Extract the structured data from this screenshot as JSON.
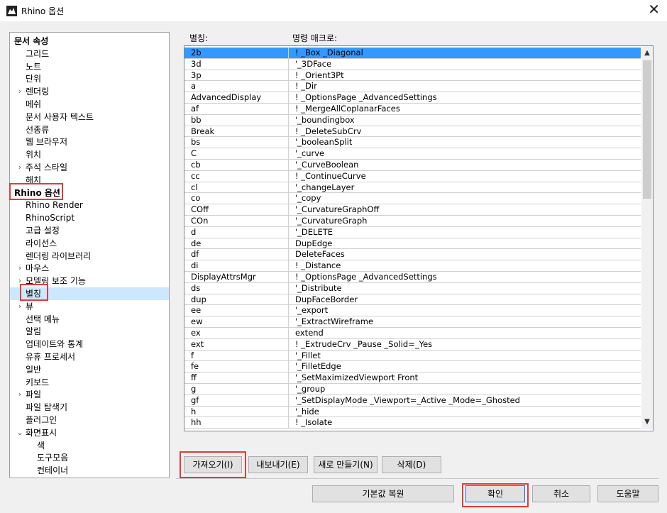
{
  "window": {
    "title": "Rhino 옵션",
    "close_glyph": "✕"
  },
  "tree": [
    {
      "label": "문서 속성",
      "indent": 0,
      "bold": true,
      "arrow": ""
    },
    {
      "label": "그리드",
      "indent": 1,
      "bold": false,
      "arrow": ""
    },
    {
      "label": "노트",
      "indent": 1,
      "bold": false,
      "arrow": ""
    },
    {
      "label": "단위",
      "indent": 1,
      "bold": false,
      "arrow": ""
    },
    {
      "label": "렌더링",
      "indent": 1,
      "bold": false,
      "arrow": "›"
    },
    {
      "label": "메쉬",
      "indent": 1,
      "bold": false,
      "arrow": ""
    },
    {
      "label": "문서 사용자 텍스트",
      "indent": 1,
      "bold": false,
      "arrow": ""
    },
    {
      "label": "선종류",
      "indent": 1,
      "bold": false,
      "arrow": ""
    },
    {
      "label": "웹 브라우저",
      "indent": 1,
      "bold": false,
      "arrow": ""
    },
    {
      "label": "위치",
      "indent": 1,
      "bold": false,
      "arrow": ""
    },
    {
      "label": "주석 스타일",
      "indent": 1,
      "bold": false,
      "arrow": "›"
    },
    {
      "label": "해치",
      "indent": 1,
      "bold": false,
      "arrow": ""
    },
    {
      "label": "Rhino 옵션",
      "indent": 0,
      "bold": true,
      "arrow": ""
    },
    {
      "label": "Rhino Render",
      "indent": 1,
      "bold": false,
      "arrow": ""
    },
    {
      "label": "RhinoScript",
      "indent": 1,
      "bold": false,
      "arrow": ""
    },
    {
      "label": "고급 설정",
      "indent": 1,
      "bold": false,
      "arrow": ""
    },
    {
      "label": "라이선스",
      "indent": 1,
      "bold": false,
      "arrow": ""
    },
    {
      "label": "렌더링 라이브러리",
      "indent": 1,
      "bold": false,
      "arrow": ""
    },
    {
      "label": "마우스",
      "indent": 1,
      "bold": false,
      "arrow": "›"
    },
    {
      "label": "모델링 보조 기능",
      "indent": 1,
      "bold": false,
      "arrow": "›"
    },
    {
      "label": "별칭",
      "indent": 1,
      "bold": false,
      "arrow": "",
      "selected": true
    },
    {
      "label": "뷰",
      "indent": 1,
      "bold": false,
      "arrow": "›"
    },
    {
      "label": "선택 메뉴",
      "indent": 1,
      "bold": false,
      "arrow": ""
    },
    {
      "label": "알림",
      "indent": 1,
      "bold": false,
      "arrow": ""
    },
    {
      "label": "업데이트와 통계",
      "indent": 1,
      "bold": false,
      "arrow": ""
    },
    {
      "label": "유휴 프로세서",
      "indent": 1,
      "bold": false,
      "arrow": ""
    },
    {
      "label": "일반",
      "indent": 1,
      "bold": false,
      "arrow": ""
    },
    {
      "label": "키보드",
      "indent": 1,
      "bold": false,
      "arrow": ""
    },
    {
      "label": "파일",
      "indent": 1,
      "bold": false,
      "arrow": "›"
    },
    {
      "label": "파일 탐색기",
      "indent": 1,
      "bold": false,
      "arrow": ""
    },
    {
      "label": "플러그인",
      "indent": 1,
      "bold": false,
      "arrow": ""
    },
    {
      "label": "화면표시",
      "indent": 1,
      "bold": false,
      "arrow": "⌄"
    },
    {
      "label": "색",
      "indent": 2,
      "bold": false,
      "arrow": ""
    },
    {
      "label": "도구모음",
      "indent": 2,
      "bold": false,
      "arrow": ""
    },
    {
      "label": "컨테이너",
      "indent": 2,
      "bold": false,
      "arrow": ""
    }
  ],
  "columns": {
    "alias": "별칭:",
    "macro": "명령 매크로:"
  },
  "aliases": [
    {
      "alias": "2b",
      "macro": "! _Box _Diagonal",
      "selected": true
    },
    {
      "alias": "3d",
      "macro": "'_3DFace"
    },
    {
      "alias": "3p",
      "macro": "! _Orient3Pt"
    },
    {
      "alias": "a",
      "macro": "! _Dir"
    },
    {
      "alias": "AdvancedDisplay",
      "macro": "! _OptionsPage _AdvancedSettings"
    },
    {
      "alias": "af",
      "macro": "! _MergeAllCoplanarFaces"
    },
    {
      "alias": "bb",
      "macro": "'_boundingbox"
    },
    {
      "alias": "Break",
      "macro": "! _DeleteSubCrv"
    },
    {
      "alias": "bs",
      "macro": "'_booleanSplit"
    },
    {
      "alias": "C",
      "macro": "'_curve"
    },
    {
      "alias": "cb",
      "macro": "'_CurveBoolean"
    },
    {
      "alias": "cc",
      "macro": "! _ContinueCurve"
    },
    {
      "alias": "cl",
      "macro": "'_changeLayer"
    },
    {
      "alias": "co",
      "macro": "'_copy"
    },
    {
      "alias": "COff",
      "macro": "'_CurvatureGraphOff"
    },
    {
      "alias": "COn",
      "macro": "'_CurvatureGraph"
    },
    {
      "alias": "d",
      "macro": "'_DELETE"
    },
    {
      "alias": "de",
      "macro": "DupEdge"
    },
    {
      "alias": "df",
      "macro": "DeleteFaces"
    },
    {
      "alias": "di",
      "macro": "! _Distance"
    },
    {
      "alias": "DisplayAttrsMgr",
      "macro": "! _OptionsPage _AdvancedSettings"
    },
    {
      "alias": "ds",
      "macro": "'_Distribute"
    },
    {
      "alias": "dup",
      "macro": "DupFaceBorder"
    },
    {
      "alias": "ee",
      "macro": "'_export"
    },
    {
      "alias": "ew",
      "macro": "'_ExtractWireframe"
    },
    {
      "alias": "ex",
      "macro": "extend"
    },
    {
      "alias": "ext",
      "macro": "! _ExtrudeCrv _Pause _Solid=_Yes"
    },
    {
      "alias": "f",
      "macro": "'_Fillet"
    },
    {
      "alias": "fe",
      "macro": "'_FilletEdge"
    },
    {
      "alias": "ff",
      "macro": "'_SetMaximizedViewport Front"
    },
    {
      "alias": "g",
      "macro": "'_group"
    },
    {
      "alias": "gf",
      "macro": "'_SetDisplayMode _Viewport=_Active _Mode=_Ghosted"
    },
    {
      "alias": "h",
      "macro": "'_hide"
    },
    {
      "alias": "hh",
      "macro": "! _Isolate"
    }
  ],
  "scroll": {
    "up": "▲",
    "down": "▼"
  },
  "actions": {
    "import": "가져오기(I)",
    "export": "내보내기(E)",
    "new": "새로 만들기(N)",
    "delete": "삭제(D)"
  },
  "footer": {
    "restore": "기본값 복원",
    "ok": "확인",
    "cancel": "취소",
    "help": "도움말"
  },
  "colors": {
    "selection": "#3399ff",
    "tree_selection": "#cce8ff",
    "highlight": "#e03c3c"
  }
}
